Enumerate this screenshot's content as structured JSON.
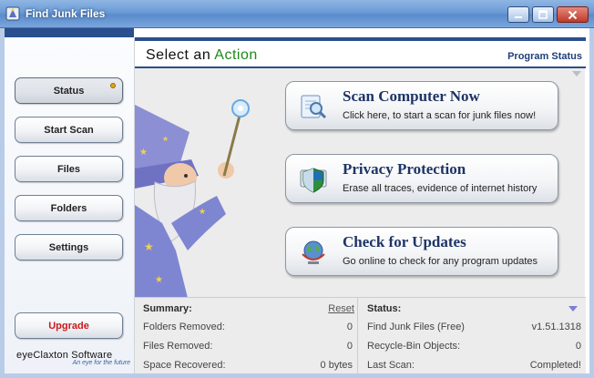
{
  "window": {
    "title": "Find Junk Files"
  },
  "sidebar": {
    "items": [
      {
        "label": "Status"
      },
      {
        "label": "Start Scan"
      },
      {
        "label": "Files"
      },
      {
        "label": "Folders"
      },
      {
        "label": "Settings"
      }
    ],
    "upgrade_label": "Upgrade",
    "brand_name": "eyeClaxton Software",
    "brand_tagline": "An eye for the future"
  },
  "header": {
    "title_prefix": "Select an ",
    "title_accent": "Action",
    "program_status": "Program Status"
  },
  "actions": [
    {
      "title": "Scan Computer Now",
      "description": "Click here, to start a scan for junk files now!",
      "icon": "scan-magnifier-icon"
    },
    {
      "title": "Privacy Protection",
      "description": "Erase all traces, evidence of internet history",
      "icon": "shield-icon"
    },
    {
      "title": "Check for Updates",
      "description": "Go online to check for any program updates",
      "icon": "globe-update-icon"
    }
  ],
  "summary": {
    "heading": "Summary:",
    "reset_label": "Reset",
    "rows": [
      {
        "label": "Folders Removed:",
        "value": "0"
      },
      {
        "label": "Files Removed:",
        "value": "0"
      },
      {
        "label": "Space Recovered:",
        "value": "0 bytes"
      }
    ]
  },
  "status": {
    "heading": "Status:",
    "rows": [
      {
        "label": "Find Junk Files (Free)",
        "value": "v1.51.1318"
      },
      {
        "label": "Recycle-Bin Objects:",
        "value": "0"
      },
      {
        "label": "Last Scan:",
        "value": "Completed!"
      }
    ]
  },
  "colors": {
    "accent_navy": "#2b4f8e",
    "title_green": "#1a8a1a",
    "upgrade_red": "#c81a1a"
  }
}
